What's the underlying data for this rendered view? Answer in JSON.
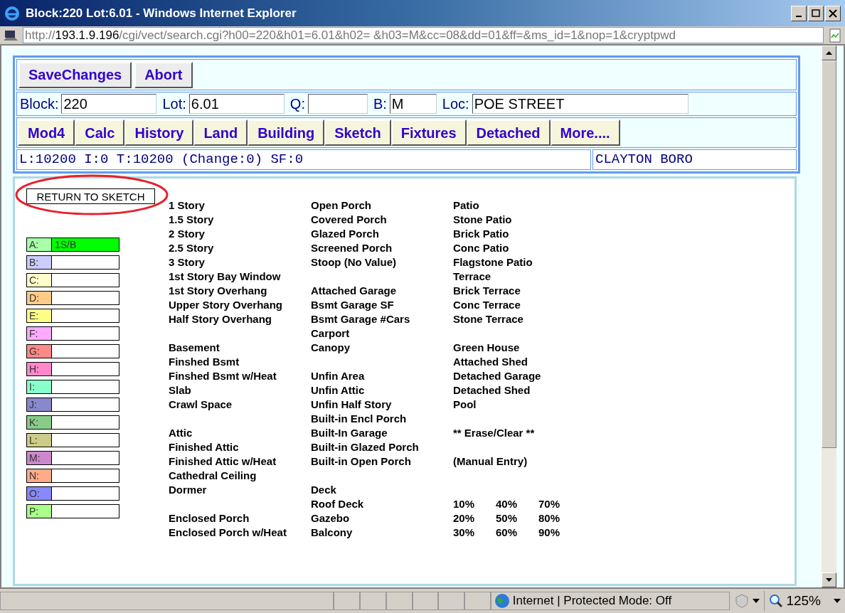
{
  "window": {
    "title": "Block:220 Lot:6.01 - Windows Internet Explorer"
  },
  "address_bar": {
    "scheme": "http://",
    "host": "193.1.9.196",
    "path": "/cgi/vect/search.cgi?h00=220&h01=6.01&h02= &h03=M&cc=08&dd=01&ff=&ms_id=1&nop=1&cryptpwd"
  },
  "action_buttons": [
    "SaveChanges",
    "Abort"
  ],
  "fields": [
    {
      "label": "Block:",
      "value": "220"
    },
    {
      "label": "Lot:",
      "value": "6.01"
    },
    {
      "label": "Q:"
    },
    {
      "label": "B:",
      "value": "M"
    },
    {
      "label": "Loc:",
      "value": "POE STREET"
    }
  ],
  "nav_buttons": [
    "Mod4",
    "Calc",
    "History",
    "Land",
    "Building",
    "Sketch",
    "Fixtures",
    "Detached",
    "More...."
  ],
  "summary": {
    "values": "L:10200 I:0 T:10200 (Change:0) SF:0",
    "municipality": "CLAYTON BORO"
  },
  "return_button": "RETURN TO SKETCH",
  "sections": [
    {
      "label": "A:",
      "color": "#aaffaa",
      "value": "1S/B"
    },
    {
      "label": "B:",
      "color": "#ccccff"
    },
    {
      "label": "C:",
      "color": "#ffffcc"
    },
    {
      "label": "D:",
      "color": "#ffcc88"
    },
    {
      "label": "E:",
      "color": "#ffff88"
    },
    {
      "label": "F:",
      "color": "#ffaaff"
    },
    {
      "label": "G:",
      "color": "#ff8888"
    },
    {
      "label": "H:",
      "color": "#ff88cc"
    },
    {
      "label": "I:",
      "color": "#88ffcc"
    },
    {
      "label": "J:",
      "color": "#8888cc"
    },
    {
      "label": "K:",
      "color": "#88cc88"
    },
    {
      "label": "L:",
      "color": "#cccc88"
    },
    {
      "label": "M:",
      "color": "#cc88cc"
    },
    {
      "label": "N:",
      "color": "#ffaa88"
    },
    {
      "label": "O:",
      "color": "#8888ff"
    },
    {
      "label": "P:",
      "color": "#aaff88"
    }
  ],
  "option_columns": [
    [
      [
        "1 Story",
        "1.5 Story",
        "2 Story",
        "2.5 Story",
        "3 Story",
        "1st Story Bay Window",
        "1st Story Overhang",
        "Upper Story Overhang",
        "Half Story Overhang"
      ],
      [
        "Basement",
        "Finshed Bsmt",
        "Finshed Bsmt w/Heat",
        "Slab",
        "Crawl Space"
      ],
      [
        "Attic",
        "Finished Attic",
        "Finished Attic w/Heat",
        "Cathedral Ceiling",
        "Dormer"
      ],
      [
        "Enclosed Porch",
        "Enclosed Porch w/Heat"
      ]
    ],
    [
      [
        "Open Porch",
        "Covered Porch",
        "Glazed Porch",
        "Screened Porch",
        "Stoop (No Value)"
      ],
      [
        "Attached Garage",
        "Bsmt Garage SF",
        "Bsmt Garage #Cars",
        "Carport",
        "Canopy"
      ],
      [
        "Unfin Area",
        "Unfin Attic",
        "Unfin Half Story",
        "Built-in Encl Porch",
        "Built-In Garage",
        "Built-in Glazed Porch",
        "Built-in Open Porch"
      ],
      [
        "Deck",
        "Roof Deck",
        "Gazebo",
        "Balcony"
      ]
    ],
    [
      [
        "Patio",
        "Stone Patio",
        "Brick Patio",
        "Conc Patio",
        "Flagstone Patio",
        "Terrace",
        "Brick Terrace",
        "Conc Terrace",
        "Stone Terrace"
      ],
      [
        "Green House",
        "Attached Shed",
        "Detached Garage",
        "Detached Shed",
        "Pool"
      ],
      [
        "** Erase/Clear **"
      ],
      [
        "(Manual Entry)"
      ]
    ]
  ],
  "percent_options": [
    [
      "10%",
      "40%",
      "70%"
    ],
    [
      "20%",
      "50%",
      "80%"
    ],
    [
      "30%",
      "60%",
      "90%"
    ]
  ],
  "status_bar": {
    "zone": "Internet | Protected Mode: Off",
    "zoom": "125%"
  }
}
